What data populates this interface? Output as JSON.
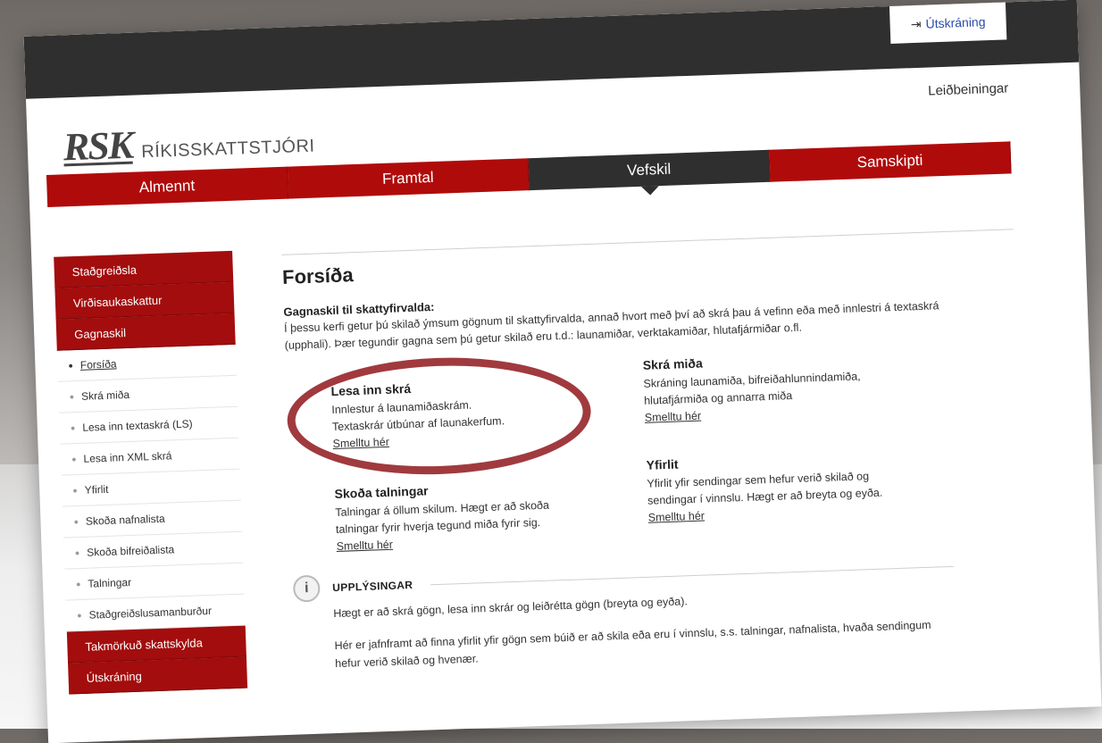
{
  "header": {
    "logout_label": "Útskráning",
    "help_label": "Leiðbeiningar",
    "logo_abbr": "RSK",
    "logo_name": "RÍKISSKATTSTJÓRI"
  },
  "nav": {
    "items": [
      {
        "label": "Almennt"
      },
      {
        "label": "Framtal"
      },
      {
        "label": "Vefskil"
      },
      {
        "label": "Samskipti"
      }
    ]
  },
  "sidebar": {
    "top": [
      {
        "label": "Staðgreiðsla"
      },
      {
        "label": "Virðisaukaskattur"
      },
      {
        "label": "Gagnaskil"
      }
    ],
    "links": [
      {
        "label": "Forsíða"
      },
      {
        "label": "Skrá miða"
      },
      {
        "label": "Lesa inn textaskrá (LS)"
      },
      {
        "label": "Lesa inn XML skrá"
      },
      {
        "label": "Yfirlit"
      },
      {
        "label": "Skoða nafnalista"
      },
      {
        "label": "Skoða bifreiðalista"
      },
      {
        "label": "Talningar"
      },
      {
        "label": "Staðgreiðslusamanburður"
      }
    ],
    "bottom": [
      {
        "label": "Takmörkuð skattskylda"
      },
      {
        "label": "Útskráning"
      }
    ]
  },
  "main": {
    "title": "Forsíða",
    "intro_title": "Gagnaskil til skattyfirvalda:",
    "intro_text": "Í þessu kerfi getur þú skilað ýmsum gögnum til skattyfirvalda, annað hvort með því að skrá þau á vefinn eða með innlestri á textaskrá (upphali). Þær tegundir gagna sem þú getur skilað eru t.d.: launamiðar, verktakamiðar, hlutafjármiðar o.fl.",
    "cards": [
      {
        "title": "Lesa inn skrá",
        "line1": "Innlestur á launamiðaskrám.",
        "line2": "Textaskrár útbúnar af launakerfum.",
        "link": "Smelltu hér"
      },
      {
        "title": "Skrá miða",
        "line1": "Skráning launamiða, bifreiðahlunnindamiða,",
        "line2": "hlutafjármiða og annarra miða",
        "link": "Smelltu hér"
      },
      {
        "title": "Skoða talningar",
        "line1": "Talningar á öllum skilum.  Hægt er að skoða",
        "line2": "talningar fyrir hverja tegund miða fyrir sig.",
        "link": "Smelltu hér"
      },
      {
        "title": "Yfirlit",
        "line1": "Yfirlit yfir sendingar sem hefur verið skilað og",
        "line2": "sendingar í vinnslu.  Hægt er að breyta og eyða.",
        "link": "Smelltu hér"
      }
    ]
  },
  "info": {
    "icon": "info-icon",
    "title": "UPPLÝSINGAR",
    "p1": "Hægt er að skrá gögn, lesa inn skrár og leiðrétta gögn (breyta og eyða).",
    "p2": "Hér er jafnframt að finna yfirlit yfir gögn sem búið er að skila eða eru í vinnslu, s.s. talningar, nafnalista, hvaða sendingum hefur verið skilað og hvenær."
  },
  "colors": {
    "brand_red": "#b00b0b",
    "dark_bar": "#2f2f2f",
    "annotation_oval": "#a03a3e"
  }
}
